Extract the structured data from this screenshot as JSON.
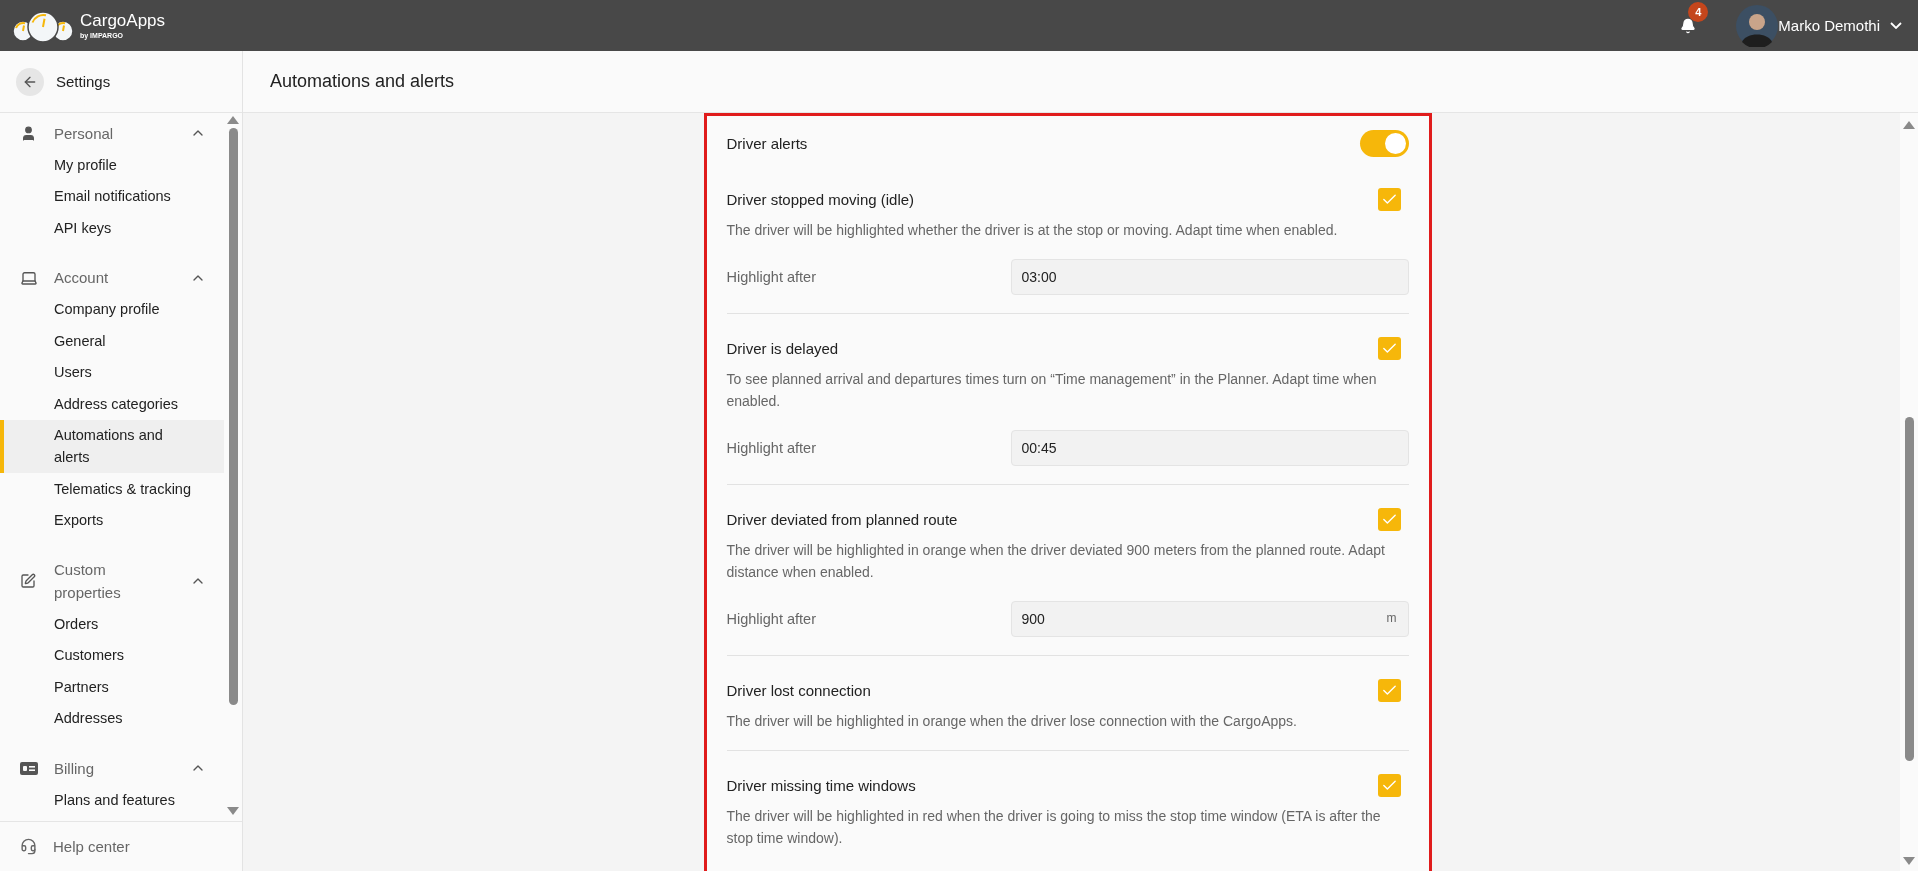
{
  "header": {
    "logo": {
      "name": "CargoApps",
      "tagline": "by IMPARGO"
    },
    "notifications": {
      "count": "4"
    },
    "user": {
      "name": "Marko Demothi"
    }
  },
  "sidebar": {
    "back_label": "Settings",
    "sections": [
      {
        "title": "Personal",
        "expanded": true,
        "items": [
          {
            "label": "My profile",
            "selected": false
          },
          {
            "label": "Email notifications",
            "selected": false
          },
          {
            "label": "API keys",
            "selected": false
          }
        ]
      },
      {
        "title": "Account",
        "expanded": true,
        "items": [
          {
            "label": "Company profile",
            "selected": false
          },
          {
            "label": "General",
            "selected": false
          },
          {
            "label": "Users",
            "selected": false
          },
          {
            "label": "Address categories",
            "selected": false
          },
          {
            "label": "Automations and alerts",
            "selected": true
          },
          {
            "label": "Telematics & tracking",
            "selected": false
          },
          {
            "label": "Exports",
            "selected": false
          }
        ]
      },
      {
        "title": "Custom properties",
        "expanded": true,
        "items": [
          {
            "label": "Orders",
            "selected": false
          },
          {
            "label": "Customers",
            "selected": false
          },
          {
            "label": "Partners",
            "selected": false
          },
          {
            "label": "Addresses",
            "selected": false
          }
        ]
      },
      {
        "title": "Billing",
        "expanded": true,
        "items": [
          {
            "label": "Plans and features",
            "selected": false
          }
        ]
      }
    ],
    "footer": "Help center"
  },
  "page": {
    "title": "Automations and alerts"
  },
  "alerts": {
    "title": "Driver alerts",
    "on": true,
    "rules": [
      {
        "title": "Driver stopped moving (idle)",
        "checked": true,
        "description": "The driver will be highlighted whether the driver is at the stop or moving. Adapt time when enabled.",
        "field": {
          "label": "Highlight after",
          "value": "03:00"
        }
      },
      {
        "title": "Driver is delayed",
        "checked": true,
        "description": "To see planned arrival and departures times turn on “Time management” in the Planner. Adapt time when enabled.",
        "field": {
          "label": "Highlight after",
          "value": "00:45"
        }
      },
      {
        "title": "Driver deviated from planned route",
        "checked": true,
        "description": "The driver will be highlighted in orange when the driver deviated 900 meters from the planned route. Adapt distance when enabled.",
        "field": {
          "label": "Highlight after",
          "value": "900",
          "unit": "m"
        }
      },
      {
        "title": "Driver lost connection",
        "checked": true,
        "description": "The driver will be highlighted in orange when the driver lose connection with the CargoApps."
      },
      {
        "title": "Driver missing time windows",
        "checked": true,
        "description": "The driver will be highlighted in red when the driver is going to miss the stop time window (ETA is after the stop time window)."
      }
    ]
  }
}
